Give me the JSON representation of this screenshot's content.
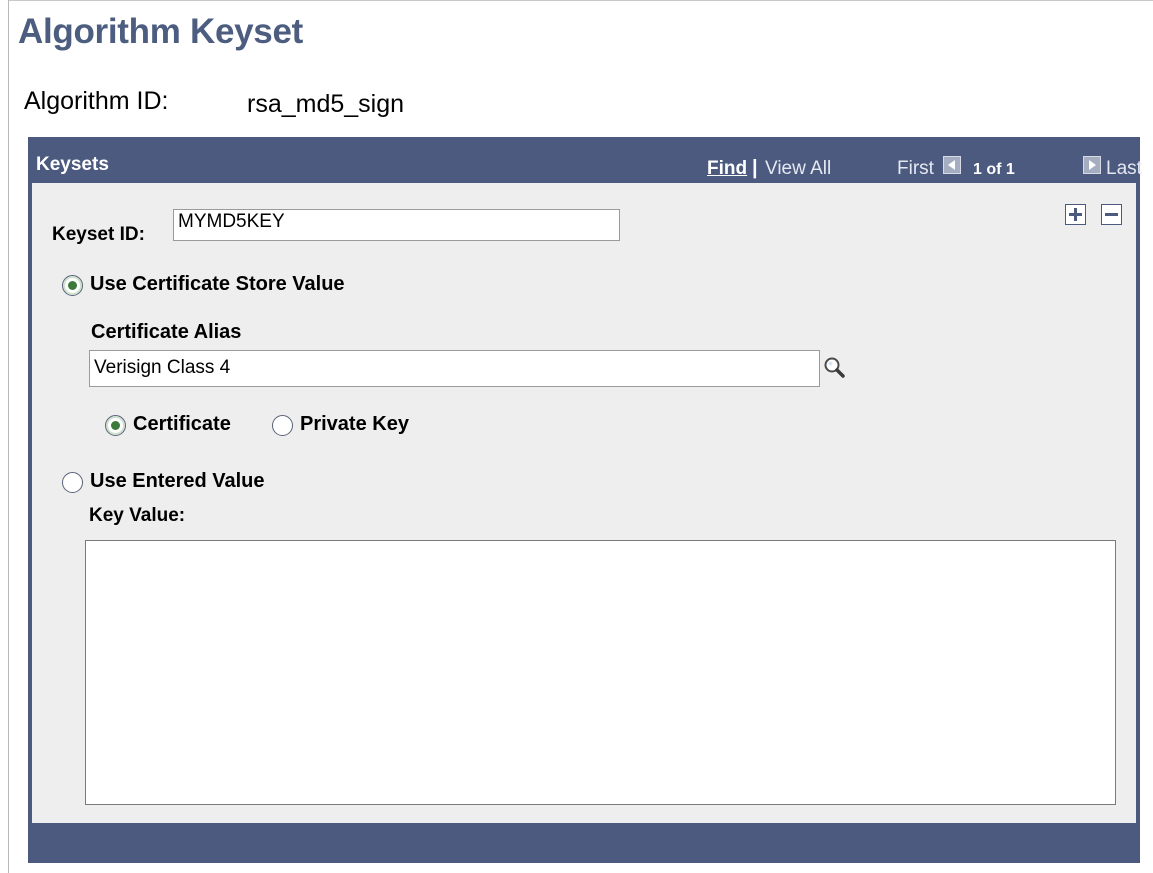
{
  "page": {
    "title": "Algorithm Keyset",
    "algorithm_id_label": "Algorithm ID:",
    "algorithm_id_value": "rsa_md5_sign"
  },
  "grid": {
    "title": "Keysets",
    "nav": {
      "find": "Find",
      "separator": "|",
      "view_all": "View All",
      "first": "First",
      "count": "1 of 1",
      "last": "Last"
    },
    "add_icon": "plus-icon",
    "delete_icon": "minus-icon"
  },
  "form": {
    "keyset_id_label": "Keyset ID:",
    "keyset_id_value": "MYMD5KEY",
    "use_cert_store_label": "Use Certificate Store Value",
    "use_cert_store_selected": true,
    "certificate_alias_label": "Certificate Alias",
    "certificate_alias_value": "Verisign Class 4",
    "lookup_icon": "magnifier-icon",
    "certificate_label": "Certificate",
    "certificate_selected": true,
    "private_key_label": "Private Key",
    "private_key_selected": false,
    "use_entered_label": "Use Entered Value",
    "use_entered_selected": false,
    "key_value_label": "Key Value:",
    "key_value": ""
  },
  "colors": {
    "title": "#4c5d80",
    "grid_header": "#4c5a80",
    "grid_body": "#eeeeee",
    "radio_dot": "#3c7a3c"
  }
}
